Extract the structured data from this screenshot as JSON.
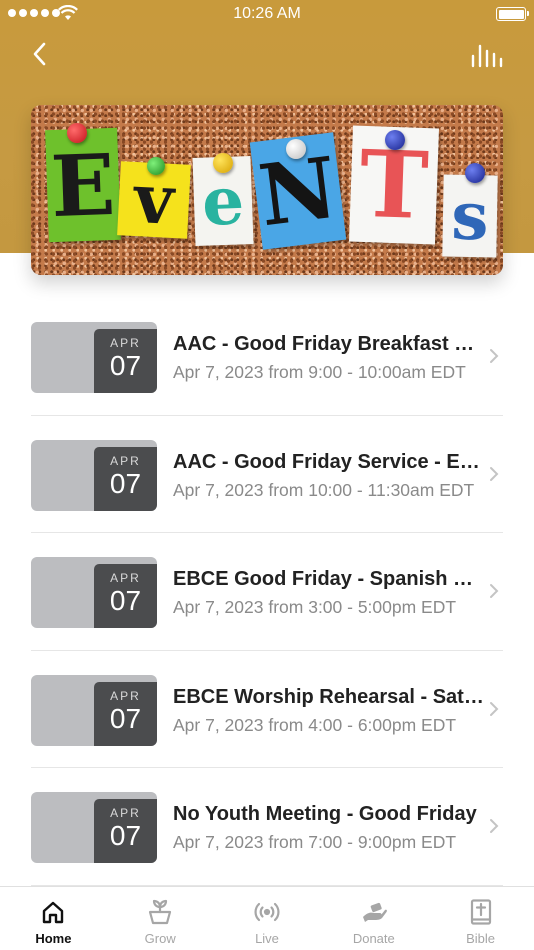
{
  "status_bar": {
    "time": "10:26 AM"
  },
  "header": {
    "banner_word": [
      "E",
      "v",
      "e",
      "N",
      "T",
      "s"
    ]
  },
  "events": [
    {
      "month": "APR",
      "day": "07",
      "title": "AAC - Good Friday Breakfast Fellowship",
      "subtitle": "Apr 7, 2023 from 9:00 - 10:00am EDT"
    },
    {
      "month": "APR",
      "day": "07",
      "title": "AAC - Good Friday Service - English",
      "subtitle": "Apr 7, 2023 from 10:00 - 11:30am EDT"
    },
    {
      "month": "APR",
      "day": "07",
      "title": "EBCE Good Friday - Spanish Service",
      "subtitle": "Apr 7, 2023 from 3:00 - 5:00pm EDT"
    },
    {
      "month": "APR",
      "day": "07",
      "title": "EBCE Worship Rehearsal - Saturday",
      "subtitle": "Apr 7, 2023 from 4:00 - 6:00pm EDT"
    },
    {
      "month": "APR",
      "day": "07",
      "title": "No Youth Meeting - Good Friday",
      "subtitle": "Apr 7, 2023 from 7:00 - 9:00pm EDT"
    }
  ],
  "tabs": [
    {
      "label": "Home",
      "icon": "home-icon",
      "active": true
    },
    {
      "label": "Grow",
      "icon": "sprout-icon",
      "active": false
    },
    {
      "label": "Live",
      "icon": "broadcast-icon",
      "active": false
    },
    {
      "label": "Donate",
      "icon": "donate-hand-icon",
      "active": false
    },
    {
      "label": "Bible",
      "icon": "bible-icon",
      "active": false
    }
  ],
  "colors": {
    "header": "#c89a3c",
    "date_box": "#4b4c4e",
    "thumb": "#bcbdc0",
    "tab_active": "#111111",
    "tab_inactive": "#a6a6a6"
  }
}
